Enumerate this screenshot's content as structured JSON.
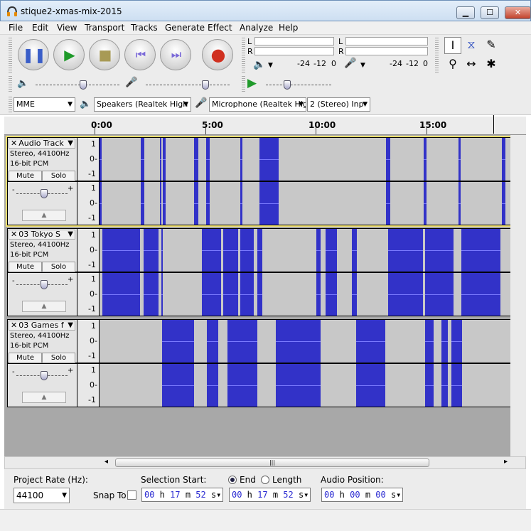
{
  "window": {
    "title": "stique2-xmas-mix-2015",
    "min": "▁",
    "max": "☐",
    "close": "✕"
  },
  "menu": [
    "File",
    "Edit",
    "View",
    "Transport",
    "Tracks",
    "Generate",
    "Effect",
    "Analyze",
    "Help"
  ],
  "transport": {
    "pause_icon": "pause-icon",
    "play_icon": "play-icon",
    "stop_icon": "stop-icon",
    "skip_start_icon": "skip-start-icon",
    "skip_end_icon": "skip-end-icon",
    "record_icon": "record-icon"
  },
  "meters": {
    "play_L": "L",
    "play_R": "R",
    "rec_L": "L",
    "rec_R": "R",
    "scale_play": [
      "-24",
      "-12",
      "0"
    ],
    "scale_rec": [
      "-24",
      "-12",
      "0"
    ]
  },
  "devices": {
    "host": "MME",
    "output": "Speakers (Realtek High",
    "input": "Microphone (Realtek Hig",
    "channels": "2 (Stereo) Inp"
  },
  "ruler": [
    "0:00",
    "5:00",
    "10:00",
    "15:00"
  ],
  "tracks": [
    {
      "name": "Audio Track",
      "info1": "Stereo, 44100Hz",
      "info2": "16-bit PCM",
      "mute": "Mute",
      "solo": "Solo",
      "selected": true,
      "scale": [
        "1",
        "0-",
        "-1"
      ]
    },
    {
      "name": "03 Tokyo S",
      "info1": "Stereo, 44100Hz",
      "info2": "16-bit PCM",
      "mute": "Mute",
      "solo": "Solo",
      "selected": false,
      "scale": [
        "1",
        "0-",
        "-1"
      ]
    },
    {
      "name": "03 Games f",
      "info1": "Stereo, 44100Hz",
      "info2": "16-bit PCM",
      "mute": "Mute",
      "solo": "Solo",
      "selected": false,
      "scale": [
        "1",
        "0-",
        "-1"
      ]
    }
  ],
  "colors": {
    "wave": "#3232c8",
    "wave_bg": "#c8c8c8",
    "selected_border": "#f0e070"
  },
  "selection": {
    "rate_label": "Project Rate (Hz):",
    "rate_value": "44100",
    "snap_label": "Snap To",
    "start_label": "Selection Start:",
    "end_label": "End",
    "length_label": "Length",
    "audio_pos_label": "Audio Position:",
    "start_time": {
      "h": "00",
      "m": "17",
      "s": "52"
    },
    "end_time": {
      "h": "00",
      "m": "17",
      "s": "52"
    },
    "pos_time": {
      "h": "00",
      "m": "00",
      "s": "00"
    }
  },
  "scroll": {
    "left": "◂",
    "right": "▸",
    "grip": "|||"
  }
}
